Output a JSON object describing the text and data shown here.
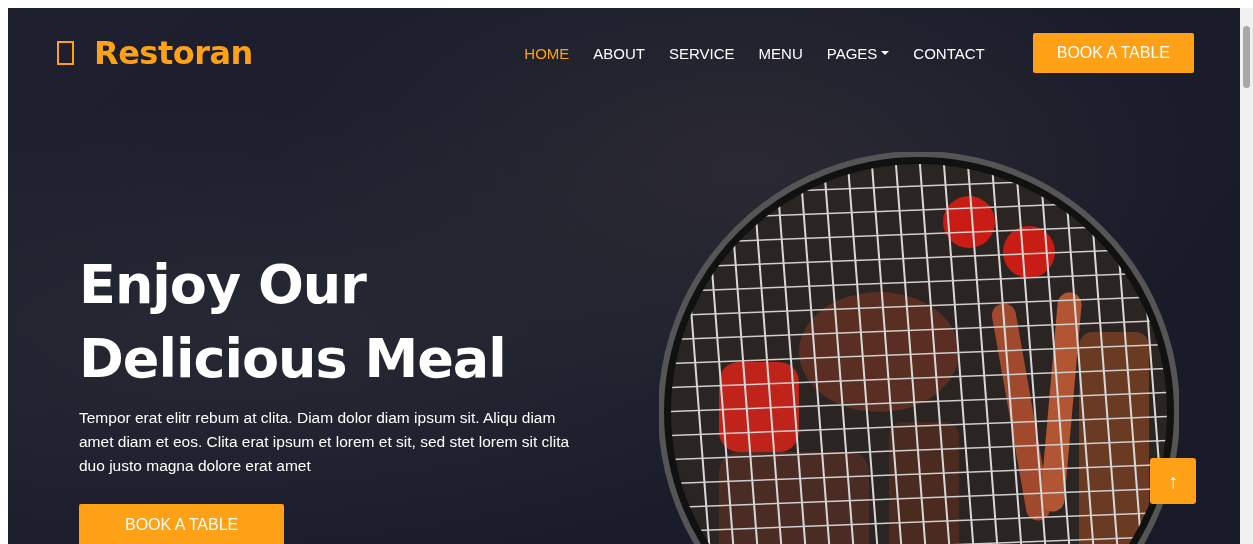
{
  "brand": {
    "name": "Restoran"
  },
  "nav": {
    "links": [
      {
        "label": "HOME",
        "selected": true,
        "kind": "link"
      },
      {
        "label": "ABOUT",
        "selected": false,
        "kind": "link"
      },
      {
        "label": "SERVICE",
        "selected": false,
        "kind": "link"
      },
      {
        "label": "MENU",
        "selected": false,
        "kind": "link"
      },
      {
        "label": "PAGES",
        "selected": false,
        "kind": "dropdown"
      },
      {
        "label": "CONTACT",
        "selected": false,
        "kind": "link"
      }
    ],
    "cta": "BOOK A TABLE"
  },
  "hero": {
    "heading_lines": [
      "Enjoy Our",
      "Delicious Meal"
    ],
    "text": "Tempor erat elitr rebum at clita. Diam dolor diam ipsum sit. Aliqu diam amet diam et eos. Clita erat ipsum et lorem et sit, sed stet lorem sit clita duo justo magna dolore erat amet",
    "button": "BOOK A TABLE"
  },
  "back_to_top": "↑"
}
